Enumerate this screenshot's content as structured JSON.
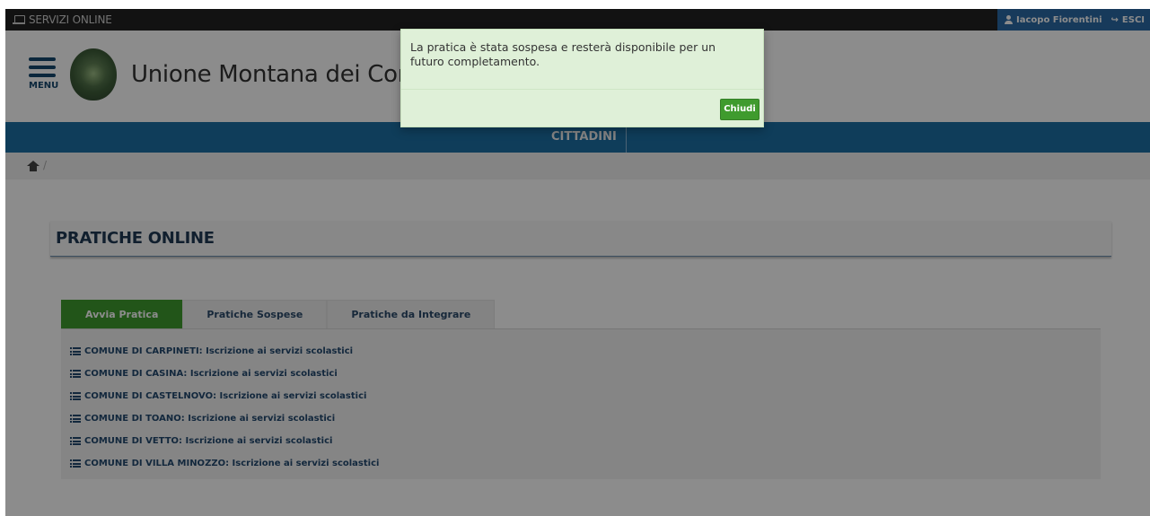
{
  "topbar": {
    "brand_label": "SERVIZI ONLINE",
    "user_name": "Iacopo Fiorentini",
    "logout_label": "ESCI"
  },
  "header": {
    "menu_label": "MENU",
    "site_title": "Unione Montana dei Comu"
  },
  "navbar": {
    "items": [
      {
        "label": "CITTADINI"
      }
    ]
  },
  "breadcrumb": {
    "separator": "/"
  },
  "main": {
    "section_title": "PRATICHE ONLINE",
    "tabs": [
      {
        "label": "Avvia Pratica",
        "active": true
      },
      {
        "label": "Pratiche Sospese",
        "active": false
      },
      {
        "label": "Pratiche da Integrare",
        "active": false
      }
    ],
    "services": [
      {
        "label": "COMUNE DI CARPINETI: Iscrizione ai servizi scolastici"
      },
      {
        "label": "COMUNE DI CASINA: Iscrizione ai servizi scolastici"
      },
      {
        "label": "COMUNE DI CASTELNOVO: Iscrizione ai servizi scolastici"
      },
      {
        "label": "COMUNE DI TOANO: Iscrizione ai servizi scolastici"
      },
      {
        "label": "COMUNE DI VETTO: Iscrizione ai servizi scolastici"
      },
      {
        "label": "COMUNE DI VILLA MINOZZO: Iscrizione ai servizi scolastici"
      }
    ]
  },
  "modal": {
    "message": "La pratica è stata sospesa e resterà disponibile per un futuro completamento.",
    "close_label": "Chiudi"
  },
  "colors": {
    "topbar_bg": "#222222",
    "accent_blue": "#1c6fa5",
    "user_chip_bg": "#2a6aa6",
    "success_green": "#3f9b2e",
    "modal_bg": "#dff0d8",
    "link_text": "#234a70"
  },
  "icons": [
    "laptop-icon",
    "user-icon",
    "sign-out-icon",
    "hamburger-menu-icon",
    "logo",
    "home-icon",
    "list-icon"
  ]
}
